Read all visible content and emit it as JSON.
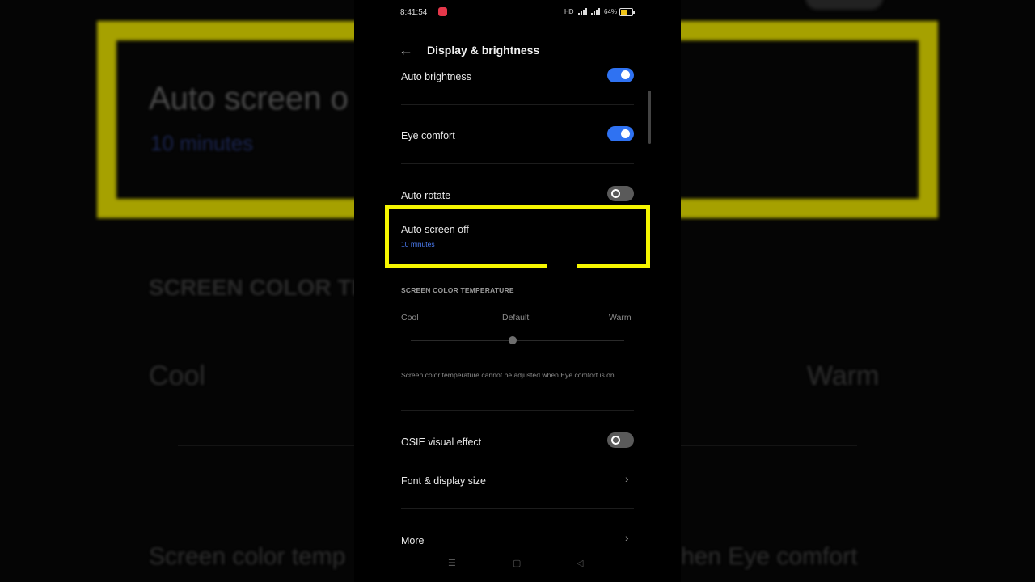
{
  "background": {
    "title": "Auto screen o",
    "subtitle": "10 minutes",
    "section": "SCREEN COLOR TE",
    "cool": "Cool",
    "warm": "Warm",
    "note_left": "Screen color temp",
    "note_right": "hen Eye comfort"
  },
  "status_bar": {
    "time": "8:41:54",
    "network": "HD",
    "battery": "64%"
  },
  "header": {
    "back_icon": "arrow-left",
    "title": "Display & brightness"
  },
  "settings": {
    "auto_brightness": {
      "label": "Auto brightness",
      "on": true
    },
    "eye_comfort": {
      "label": "Eye comfort",
      "on": true
    },
    "auto_rotate": {
      "label": "Auto rotate",
      "on": false
    },
    "auto_screen_off": {
      "label": "Auto screen off",
      "value": "10 minutes"
    },
    "color_temperature": {
      "section_title": "SCREEN COLOR TEMPERATURE",
      "cool": "Cool",
      "default": "Default",
      "warm": "Warm",
      "note": "Screen color temperature cannot be adjusted when Eye comfort is on."
    },
    "osie": {
      "label": "OSIE visual effect",
      "on": false
    },
    "font_display": {
      "label": "Font & display size"
    },
    "more": {
      "label": "More"
    }
  },
  "colors": {
    "toggle_on": "#2f72f2",
    "highlight": "#f6f600",
    "link_blue": "#4c7df5"
  }
}
